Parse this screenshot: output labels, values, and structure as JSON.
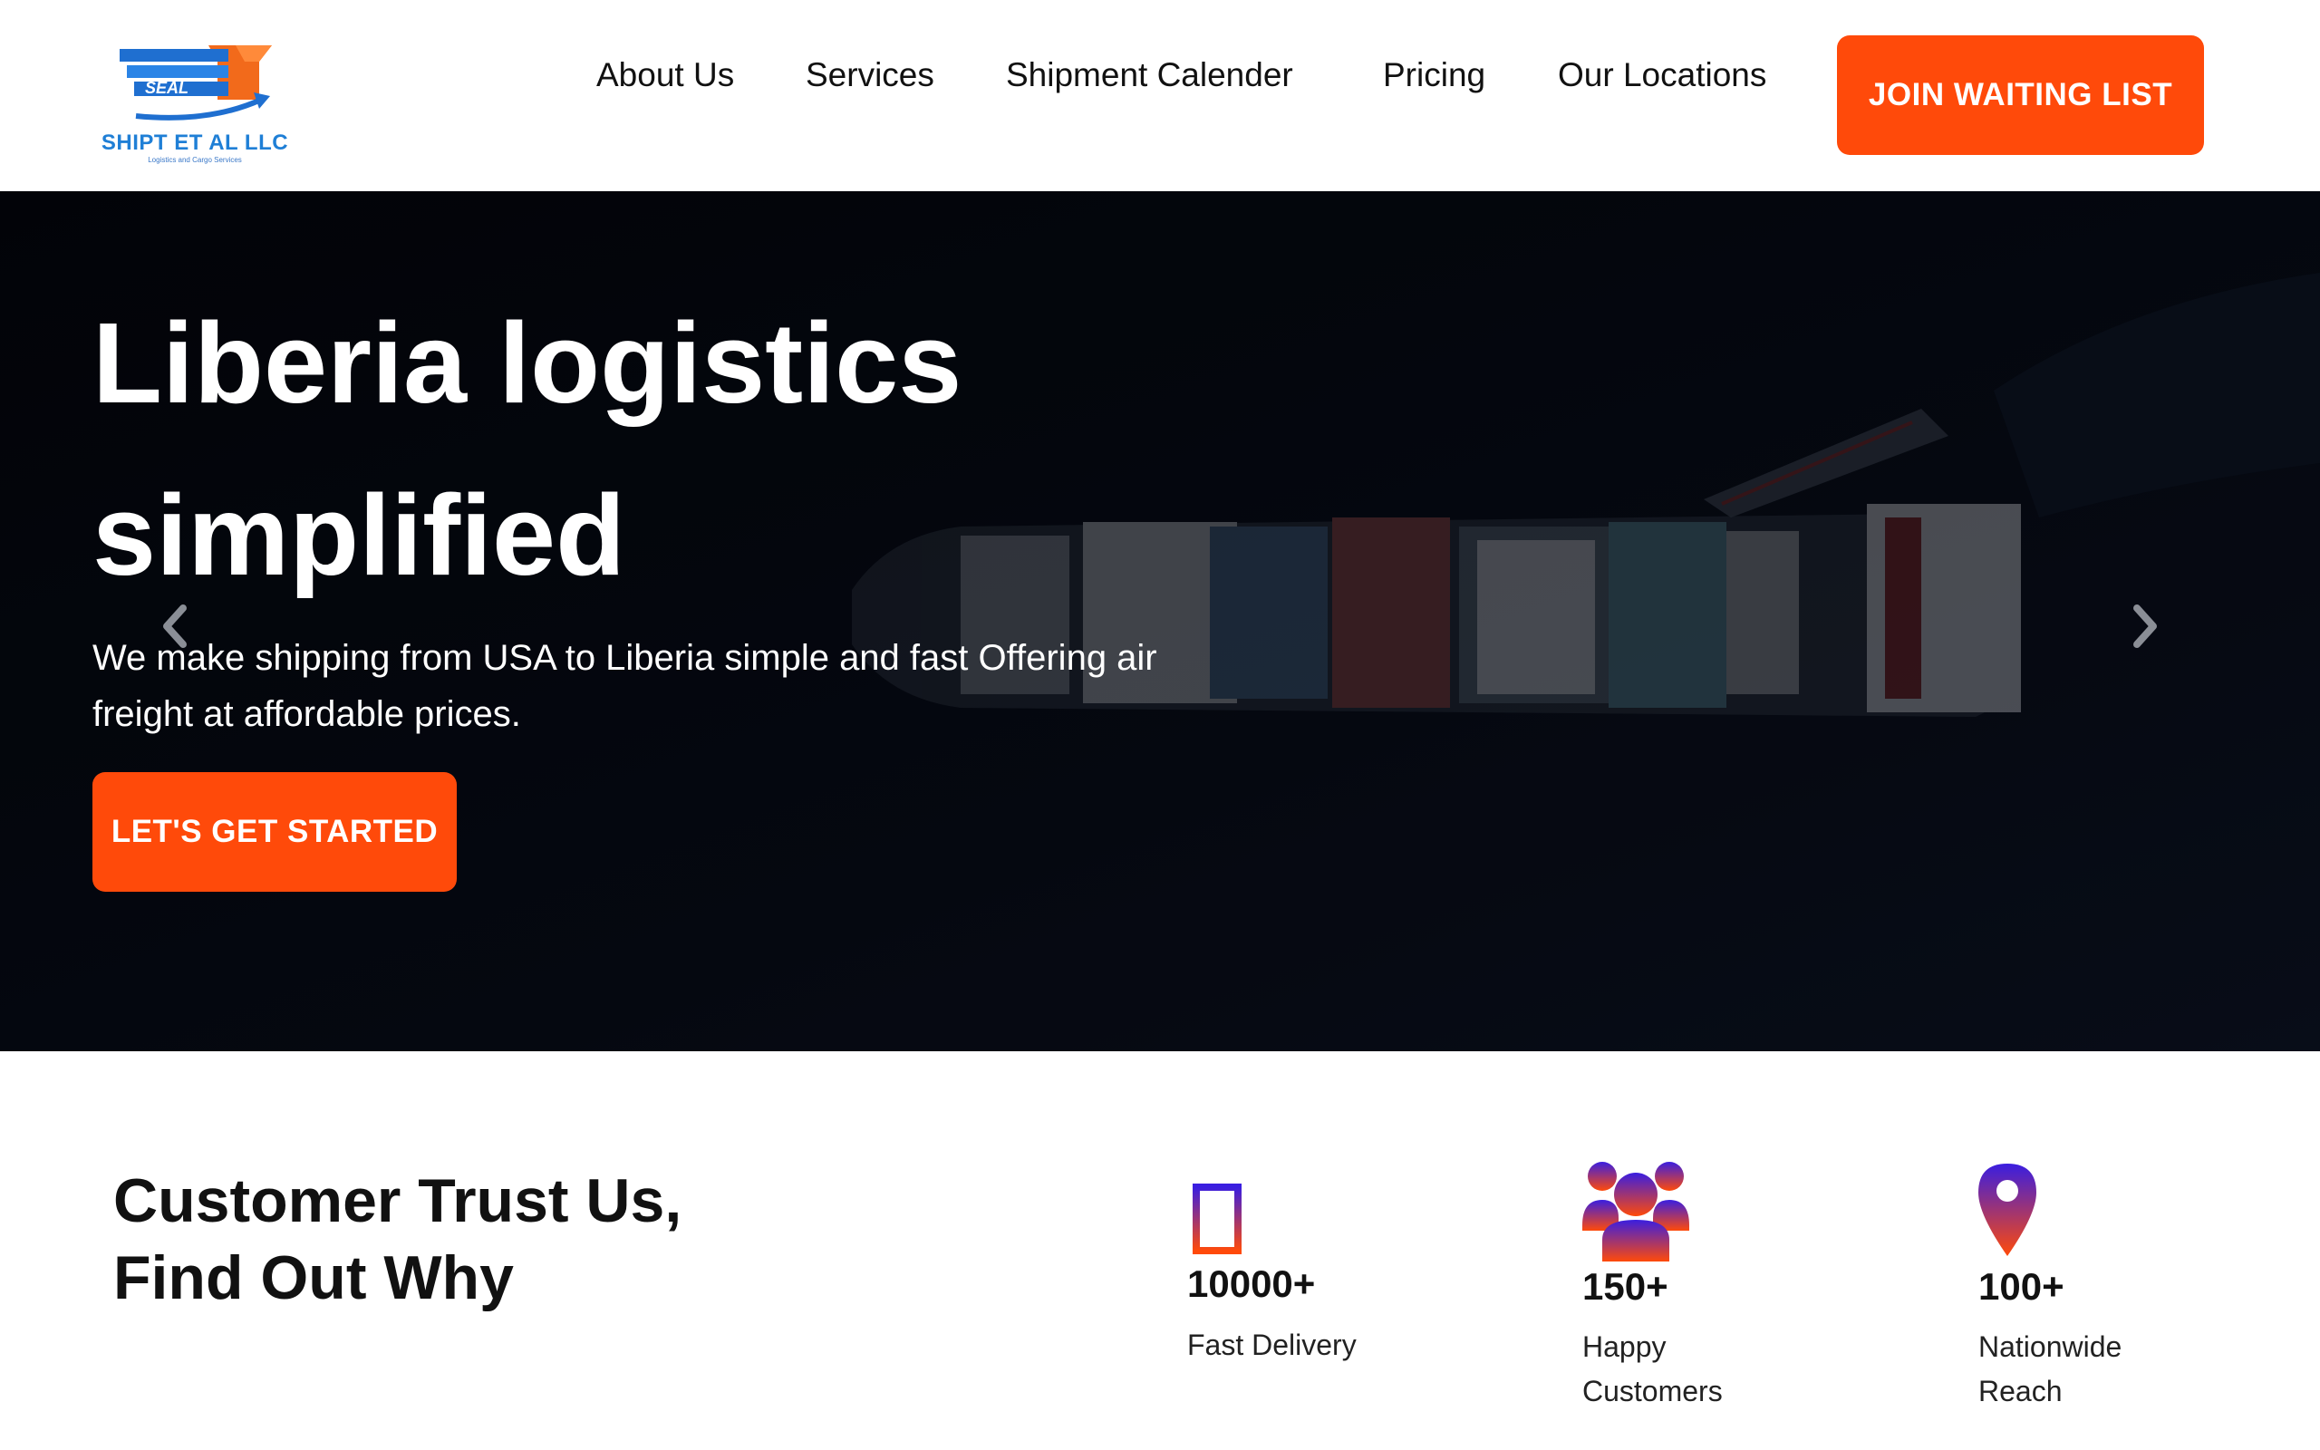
{
  "header": {
    "logo": {
      "badge": "SEAL",
      "name": "SHIPT ET AL LLC",
      "tagline": "Logistics and Cargo Services"
    },
    "nav": [
      {
        "label": "About Us"
      },
      {
        "label": "Services"
      },
      {
        "label": "Shipment Calender"
      },
      {
        "label": "Pricing"
      },
      {
        "label": "Our Locations"
      }
    ],
    "cta_label": "JOIN WAITING LIST"
  },
  "hero": {
    "title_line1": "Liberia logistics",
    "title_line2": "simplified",
    "subtitle": "We make shipping from USA to Liberia simple and fast Offering air freight at affordable prices.",
    "cta_label": "LET'S GET STARTED"
  },
  "trust": {
    "title_line1": "Customer Trust Us,",
    "title_line2": "Find Out Why",
    "stats": [
      {
        "value": "10000+",
        "label": "Fast Delivery",
        "icon": "missing-glyph-icon"
      },
      {
        "value": "150+",
        "label": "Happy Customers",
        "icon": "people-icon"
      },
      {
        "value": "100+",
        "label": "Nationwide Reach",
        "icon": "map-pin-icon"
      }
    ]
  },
  "colors": {
    "accent": "#ff4a0a",
    "hero_bg": "#04060d",
    "brand_blue": "#1f7fd6",
    "icon_gradient_top": "#3a1ee0",
    "icon_gradient_bottom": "#ff4a0a"
  }
}
